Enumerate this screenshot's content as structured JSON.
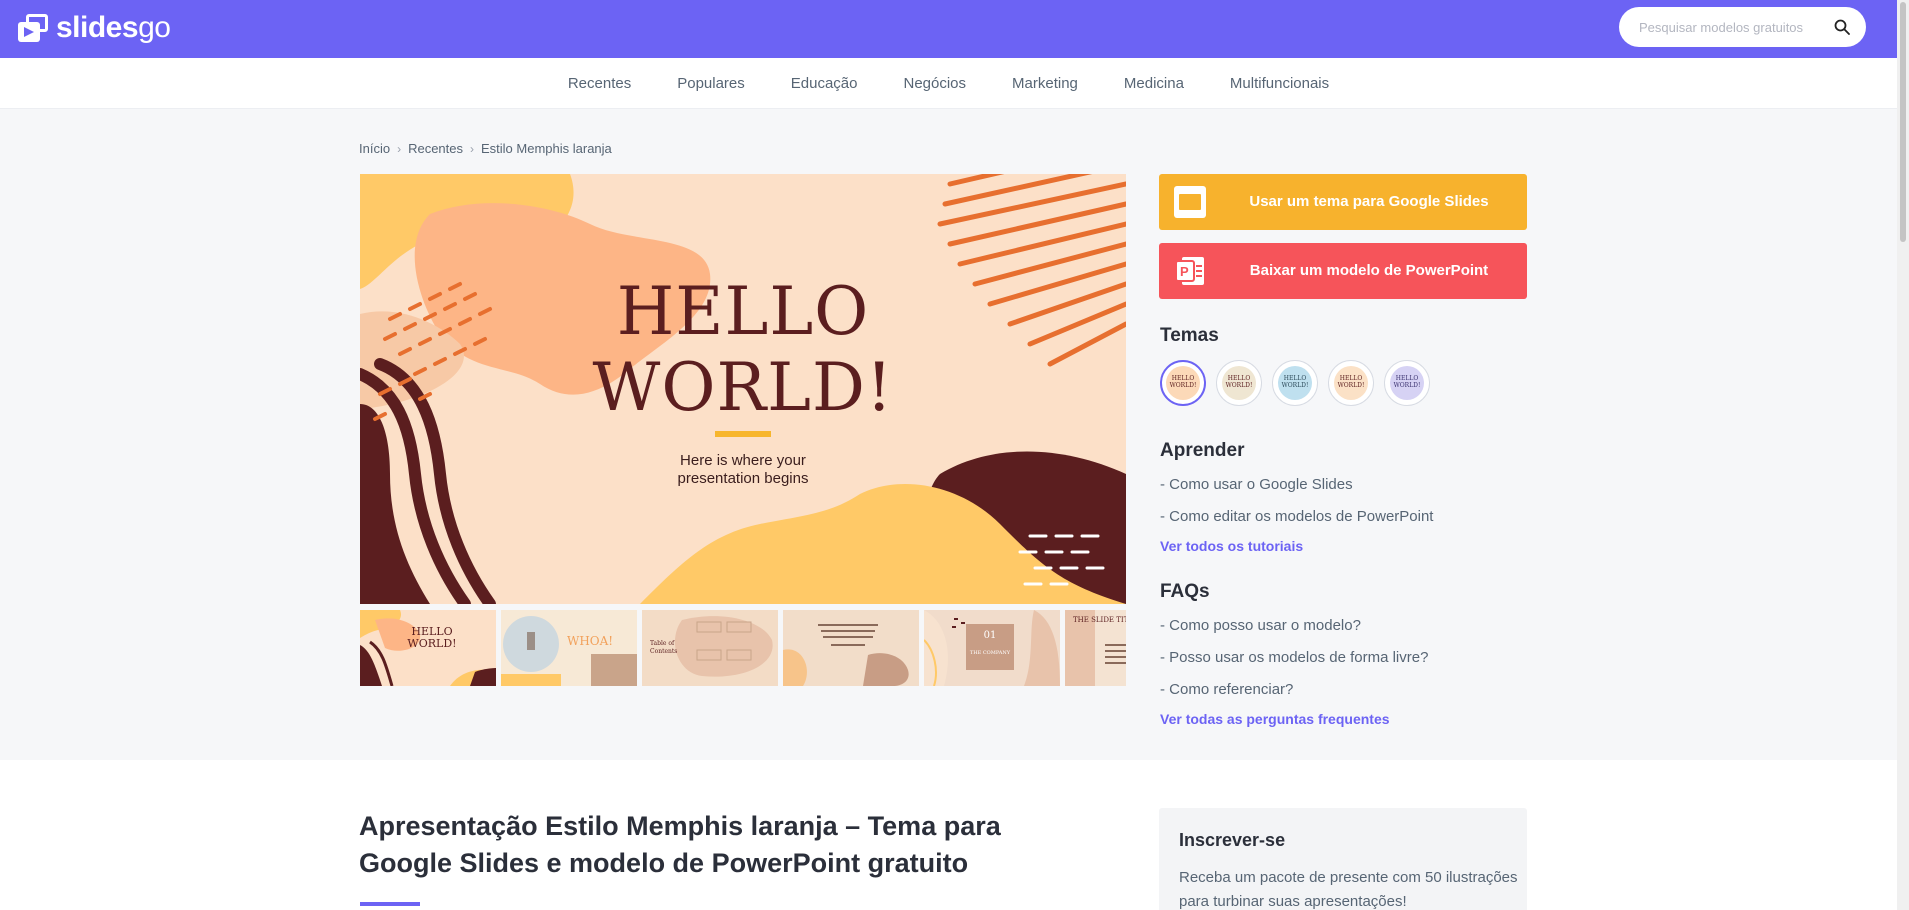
{
  "header": {
    "logo_text_bold": "slides",
    "logo_text_light": "go",
    "search_placeholder": "Pesquisar modelos gratuitos"
  },
  "categories": [
    "Recentes",
    "Populares",
    "Educação",
    "Negócios",
    "Marketing",
    "Medicina",
    "Multifuncionais"
  ],
  "breadcrumb": [
    "Início",
    "Recentes",
    "Estilo Memphis laranja"
  ],
  "preview": {
    "title_line1": "HELLO",
    "title_line2": "WORLD!",
    "subtitle_line1": "Here is where your",
    "subtitle_line2": "presentation begins"
  },
  "thumbnails": {
    "t1_title": "HELLO WORLD!",
    "t2_title": "WHOA!",
    "t3_title": "Table of Contents",
    "t5_number": "01",
    "t5_title": "THE COMPANY",
    "t6_title": "THE SLIDE TITLE GOES HERE!"
  },
  "actions": {
    "google_slides": "Usar um tema para Google Slides",
    "powerpoint": "Baixar um modelo de PowerPoint"
  },
  "themes": {
    "heading": "Temas",
    "label": "HELLO WORLD!"
  },
  "learn": {
    "heading": "Aprender",
    "links": [
      "- Como usar o Google Slides",
      "- Como editar os modelos de PowerPoint"
    ],
    "more": "Ver todos os tutoriais"
  },
  "faqs": {
    "heading": "FAQs",
    "links": [
      "- Como posso usar o modelo?",
      "- Posso usar os modelos de forma livre?",
      "- Como referenciar?"
    ],
    "more": "Ver todas as perguntas frequentes"
  },
  "article": {
    "title_line1": "Apresentação Estilo Memphis laranja – Tema para",
    "title_line2": "Google Slides e modelo de PowerPoint gratuito"
  },
  "subscribe": {
    "heading": "Inscrever-se",
    "text": "Receba um pacote de presente com 50 ilustrações para turbinar suas apresentações!"
  },
  "colors": {
    "brand": "#6c63f4",
    "google_slides": "#f7b22d",
    "powerpoint": "#f6545a"
  }
}
